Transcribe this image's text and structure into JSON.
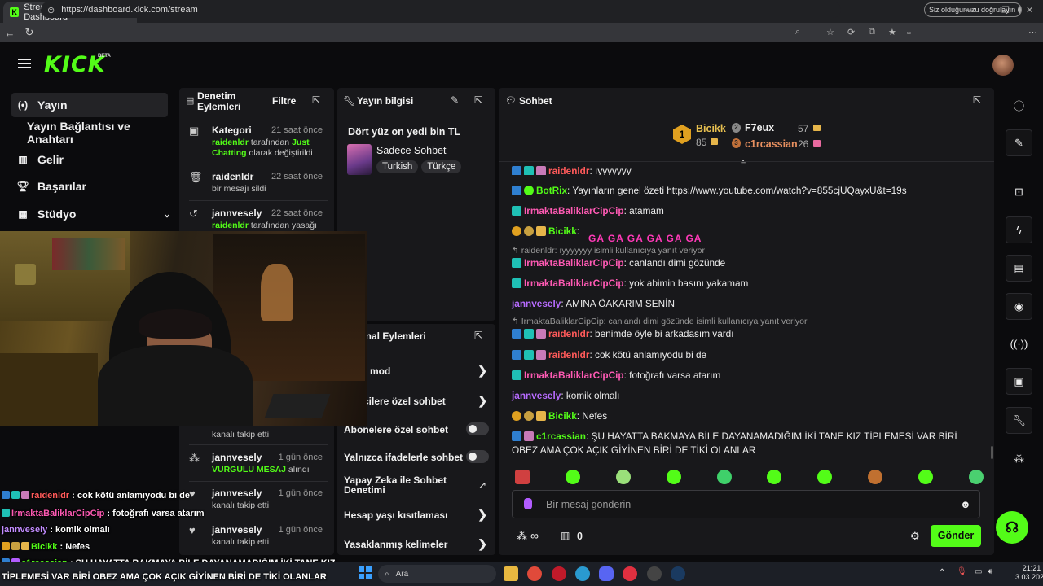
{
  "browser": {
    "tab_title": "Stream - Kick Dashboard",
    "url": "https://dashboard.kick.com/stream",
    "verify_label": "Siz olduğunuzu doğrulayın"
  },
  "header": {
    "logo": "KICK",
    "beta": "BETA"
  },
  "sidebar": {
    "items": [
      {
        "label": "Yayın",
        "icon": "broadcast-icon"
      },
      {
        "label": "Yayın Bağlantısı ve Anahtarı",
        "icon": ""
      },
      {
        "label": "Gelir",
        "icon": "chart-icon"
      },
      {
        "label": "Başarılar",
        "icon": "trophy-icon"
      },
      {
        "label": "Stüdyo",
        "icon": "studio-icon"
      }
    ]
  },
  "mod_panel": {
    "title": "Denetim Eylemleri",
    "filter": "Filtre",
    "events": [
      {
        "user": "Kategori",
        "time": "21 saat önce",
        "line1_user": "raidenldr",
        "line1_mid": " tarafından ",
        "line1_hl": "Just Chatting",
        "line1_end": " olarak değiştirildi"
      },
      {
        "user": "raidenldr",
        "time": "22 saat önce",
        "desc": "bir mesajı sildi"
      },
      {
        "user": "jannvesely",
        "time": "22 saat önce",
        "line1_user": "raidenldr",
        "line1_end": " tarafından yasağı"
      },
      {
        "desc": "kanalı takip etti"
      },
      {
        "user": "jannvesely",
        "time": "1 gün önce",
        "hl": "VURGULU MESAJ",
        "end": " alındı"
      },
      {
        "user": "jannvesely",
        "time": "1 gün önce",
        "desc": "kanalı takip etti"
      },
      {
        "user": "jannvesely",
        "time": "1 gün önce",
        "desc": "kanalı takip etti"
      }
    ]
  },
  "stream_info": {
    "title": "Yayın bilgisi",
    "stream_title": "Dört yüz on yedi bin TL",
    "category": "Sadece Sohbet",
    "tags": [
      "Turkish",
      "Türkçe"
    ]
  },
  "channel_actions": {
    "title": "Kanal Eylemleri",
    "title_visible": "anal Eylemleri",
    "rows": [
      {
        "label": "s mod",
        "type": "chevron"
      },
      {
        "label": "çilere özel sohbet",
        "type": "chevron"
      },
      {
        "label": "Abonelere özel sohbet",
        "type": "toggle"
      },
      {
        "label": "Yalnızca ifadelerle sohbet",
        "type": "toggle"
      },
      {
        "label": "Yapay Zeka ile Sohbet Denetimi",
        "type": "external"
      },
      {
        "label": "Hesap yaşı kısıtlaması",
        "type": "chevron"
      },
      {
        "label": "Yasaklanmış kelimeler",
        "type": "chevron"
      }
    ]
  },
  "chat": {
    "title": "Sohbet",
    "leaderboard": [
      {
        "rank": "1",
        "name": "Bicikk",
        "count": "85"
      },
      {
        "rank": "2",
        "name": "F7eux",
        "count": "57"
      },
      {
        "rank": "3",
        "name": "c1rcassian",
        "count": "26"
      }
    ],
    "messages": [
      {
        "name": "raidenldr",
        "color": "#ff5a5a",
        "text": ": ıyyyyyyy"
      },
      {
        "name": "BotRix",
        "color": "#ffffff",
        "text": ": Yayınların genel özeti ",
        "link": "https://www.youtube.com/watch?v=855cjUQayxU&t=19s"
      },
      {
        "name": "IrmaktaBaliklarCipCip",
        "color": "#ff5ab4",
        "text": ": atamam"
      },
      {
        "name": "Bicikk",
        "color": "#53fc18",
        "text": ":",
        "big": "GA GA GA GA GA GA"
      },
      {
        "reply": "raidenldr: ıyyyyyyy isimli kullanıcıya yanıt veriyor"
      },
      {
        "name": "IrmaktaBaliklarCipCip",
        "color": "#ff5ab4",
        "text": ": canlandı dimi gözünde"
      },
      {
        "name": "IrmaktaBaliklarCipCip",
        "color": "#ff5ab4",
        "text": ": yok abimin basını yakamam"
      },
      {
        "name": "jannvesely",
        "color": "#b76bff",
        "text": ": AMINA ÖAKARIM SENİN"
      },
      {
        "reply": "IrmaktaBaliklarCipCip: canlandı dimi gözünde isimli kullanıcıya yanıt veriyor"
      },
      {
        "name": "raidenldr",
        "color": "#ff5a5a",
        "text": ": benimde öyle bi arkadasım vardı"
      },
      {
        "name": "raidenldr",
        "color": "#ff5a5a",
        "text": ": cok kötü anlamıyodu bi de"
      },
      {
        "name": "IrmaktaBaliklarCipCip",
        "color": "#ff5ab4",
        "text": ": fotoğrafı varsa atarım"
      },
      {
        "name": "jannvesely",
        "color": "#b76bff",
        "text": ": komik olmalı"
      },
      {
        "name": "Bicikk",
        "color": "#53fc18",
        "text": ": Nefes"
      },
      {
        "name": "c1rcassian",
        "color": "#53fc18",
        "text": ": ŞU HAYATTA BAKMAYA BİLE DAYANAMADIĞIM İKİ TANE KIZ TİPLEMESİ VAR BİRİ OBEZ AMA ÇOK AÇIK GİYİNEN BİRİ DE TİKİ OLANLAR"
      }
    ],
    "input_placeholder": "Bir mesaj gönderin",
    "points": "∞",
    "shop_count": "0",
    "send": "Gönder"
  },
  "overlay": {
    "lines": [
      {
        "name": "raidenldr",
        "color": "#ff5a5a",
        "text": " : cok kötü anlamıyodu bi de"
      },
      {
        "name": "IrmaktaBaliklarCipCip",
        "color": "#ff5ab4",
        "text": " : fotoğrafı varsa atarım"
      },
      {
        "name": "jannvesely",
        "color": "#c28cff",
        "text": " : komik olmalı"
      },
      {
        "name": "Bicikk",
        "color": "#53fc18",
        "text": " : Nefes"
      },
      {
        "name": "c1rcassian",
        "color": "#53fc18",
        "text": " : ŞU HAYATTA BAKMAYA BİLE DAYANAMADIĞIM İKİ TANE KIZ"
      },
      {
        "name": "",
        "color": "#fff",
        "text": "TİPLEMESİ VAR BİRİ OBEZ AMA ÇOK AÇIK GİYİNEN BİRİ DE TİKİ OLANLAR"
      }
    ]
  },
  "taskbar": {
    "search": "Ara",
    "time": "21:21",
    "date": "3.03.2026"
  }
}
